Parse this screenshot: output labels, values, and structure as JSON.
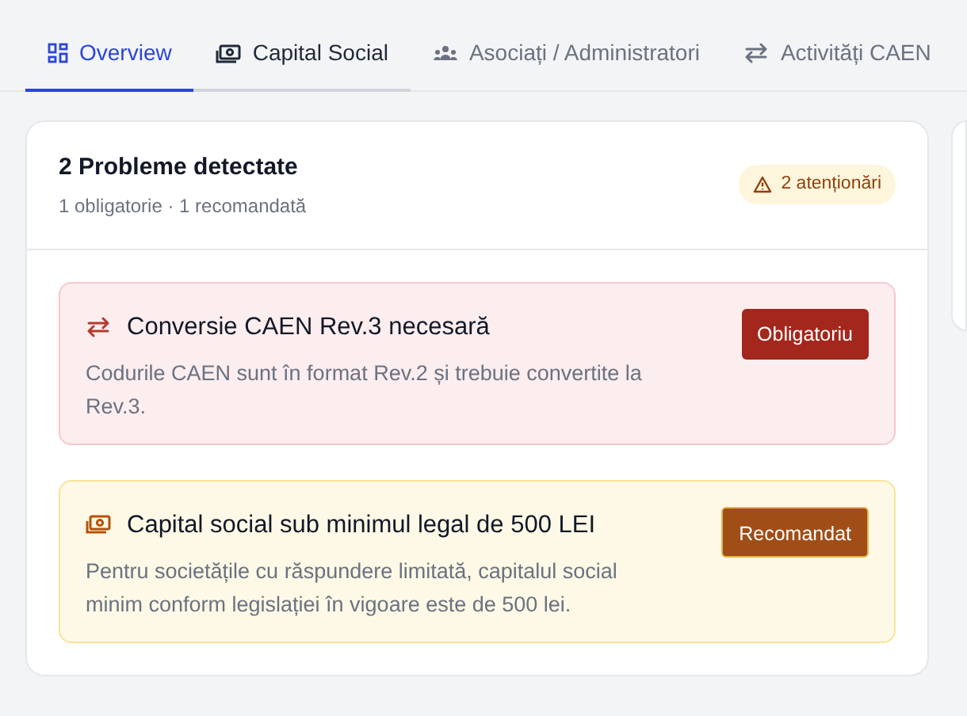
{
  "tabs": [
    {
      "label": "Overview",
      "selected": true,
      "hovered": false
    },
    {
      "label": "Capital Social",
      "selected": false,
      "hovered": true
    },
    {
      "label": "Asociați / Administratori",
      "selected": false,
      "hovered": false
    },
    {
      "label": "Activități CAEN",
      "selected": false,
      "hovered": false
    }
  ],
  "summary": {
    "title": "2 Probleme detectate",
    "subtitle": "1 obligatorie · 1 recomandată",
    "badge": "2 atenționări"
  },
  "issues": [
    {
      "kind": "required",
      "title": "Conversie CAEN Rev.3 necesară",
      "description": "Codurile CAEN sunt în format Rev.2 și trebuie convertite la Rev.3.",
      "tag": "Obligatoriu"
    },
    {
      "kind": "recommended",
      "title": "Capital social sub minimul legal de 500 LEI",
      "description": "Pentru societățile cu răspundere limitată, capitalul social minim conform legislației în vigoare este de 500 lei.",
      "tag": "Recomandat"
    }
  ]
}
